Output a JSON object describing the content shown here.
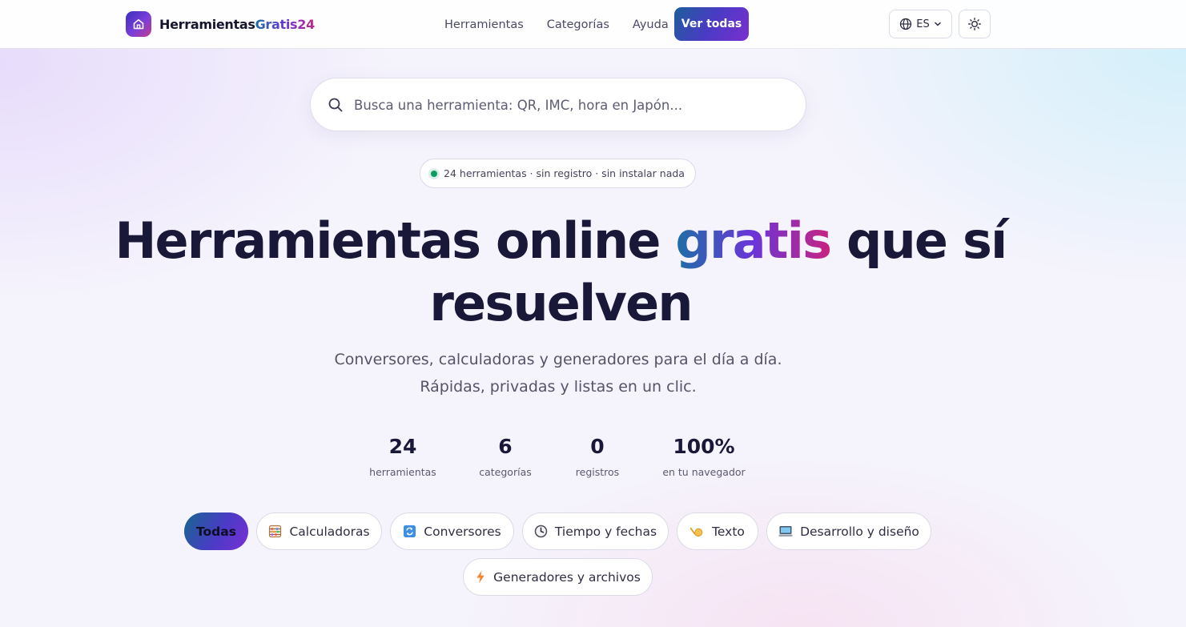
{
  "header": {
    "logo_text_a": "Herramientas",
    "logo_text_b": "Gratis24",
    "nav": [
      "Herramientas",
      "Categorías",
      "Ayuda"
    ],
    "cta_label": "Ver todas",
    "lang_label": "ES"
  },
  "search": {
    "placeholder": "Busca una herramienta: QR, IMC, hora en Japón..."
  },
  "badge": {
    "text": "24 herramientas · sin registro · sin instalar nada",
    "dot_color": "#0d9b63"
  },
  "hero": {
    "title_part1": "Herramientas online ",
    "title_accent": "gratis",
    "title_part2": " que sí resuelven",
    "subtitle": "Conversores, calculadoras y generadores para el día a día. Rápidas, privadas y listas en un clic."
  },
  "stats": [
    {
      "value": "24",
      "label": "herramientas"
    },
    {
      "value": "6",
      "label": "categorías"
    },
    {
      "value": "0",
      "label": "registros"
    },
    {
      "value": "100%",
      "label": "en tu navegador"
    }
  ],
  "categories": [
    {
      "label": "Todas",
      "icon": "",
      "active": true
    },
    {
      "label": "Calculadoras",
      "icon": "abacus-icon",
      "active": false
    },
    {
      "label": "Conversores",
      "icon": "refresh-icon",
      "active": false
    },
    {
      "label": "Tiempo y fechas",
      "icon": "clock-icon",
      "active": false
    },
    {
      "label": "Texto",
      "icon": "writing-hand-icon",
      "active": false
    },
    {
      "label": "Desarrollo y diseño",
      "icon": "computer-icon",
      "active": false
    },
    {
      "label": "Generadores y archivos",
      "icon": "lightning-icon",
      "active": false
    }
  ],
  "colors": {
    "accent_start": "#1d6fa6",
    "accent_mid": "#6a35d8",
    "accent_end": "#c8237f",
    "text_dark": "#1a1838"
  }
}
